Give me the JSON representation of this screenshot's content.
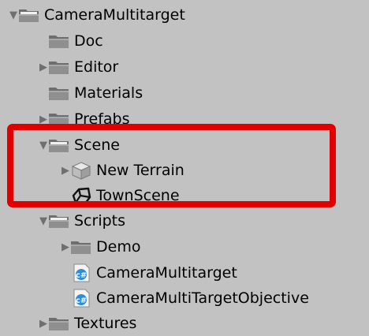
{
  "tree": {
    "items": [
      {
        "label": "CameraMultitarget",
        "icon": "folder-open-icon",
        "expanded": true
      },
      {
        "label": "Doc",
        "icon": "folder-icon",
        "expanded": false
      },
      {
        "label": "Editor",
        "icon": "folder-icon",
        "expanded": false
      },
      {
        "label": "Materials",
        "icon": "folder-icon",
        "expanded": false
      },
      {
        "label": "Prefabs",
        "icon": "folder-icon",
        "expanded": false
      },
      {
        "label": "Scene",
        "icon": "folder-open-icon",
        "expanded": true
      },
      {
        "label": "New Terrain",
        "icon": "prefab-cube-icon",
        "expanded": false
      },
      {
        "label": "TownScene",
        "icon": "unity-scene-icon",
        "expanded": false
      },
      {
        "label": "Scripts",
        "icon": "folder-open-icon",
        "expanded": true
      },
      {
        "label": "Demo",
        "icon": "folder-icon",
        "expanded": false
      },
      {
        "label": "CameraMultitarget",
        "icon": "csharp-script-icon",
        "expanded": false
      },
      {
        "label": "CameraMultiTargetObjective",
        "icon": "csharp-script-icon",
        "expanded": false
      },
      {
        "label": "Textures",
        "icon": "folder-icon",
        "expanded": false
      }
    ]
  },
  "colors": {
    "background": "#c2c2c2",
    "highlight_border": "#e00000",
    "folder": "#8a8a8a",
    "script_icon": "#2b8fd8"
  }
}
